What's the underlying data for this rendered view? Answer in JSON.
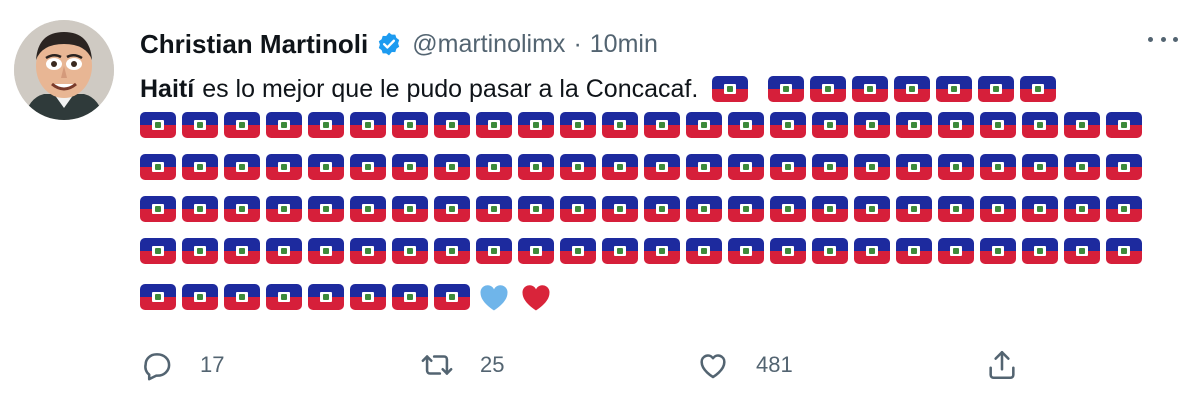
{
  "tweet": {
    "display_name": "Christian Martinoli",
    "handle": "@martinolimx",
    "separator": "·",
    "time": "10min",
    "text_bold": "Haití",
    "text_rest": "es lo mejor que le pudo pasar a la Concacaf.",
    "inline_flags_before_gap": 1,
    "inline_flags_after_gap": 7,
    "flag_rows": [
      24,
      24,
      24,
      24,
      8
    ],
    "trailing_hearts": [
      {
        "color": "#6fb5ea",
        "icon": "blue-heart-icon"
      },
      {
        "color": "#d9243a",
        "icon": "red-heart-icon"
      }
    ],
    "flag_icon": "haiti-flag-icon",
    "flag_colors": {
      "blue": "#1d2a9e",
      "red": "#d61f3a"
    }
  },
  "actions": {
    "replies": {
      "icon": "reply-icon",
      "count": "17"
    },
    "retweets": {
      "icon": "retweet-icon",
      "count": "25"
    },
    "likes": {
      "icon": "like-icon",
      "count": "481"
    },
    "share": {
      "icon": "share-icon"
    }
  },
  "colors": {
    "verified": "#1d9bf0",
    "secondary_text": "#536471"
  }
}
